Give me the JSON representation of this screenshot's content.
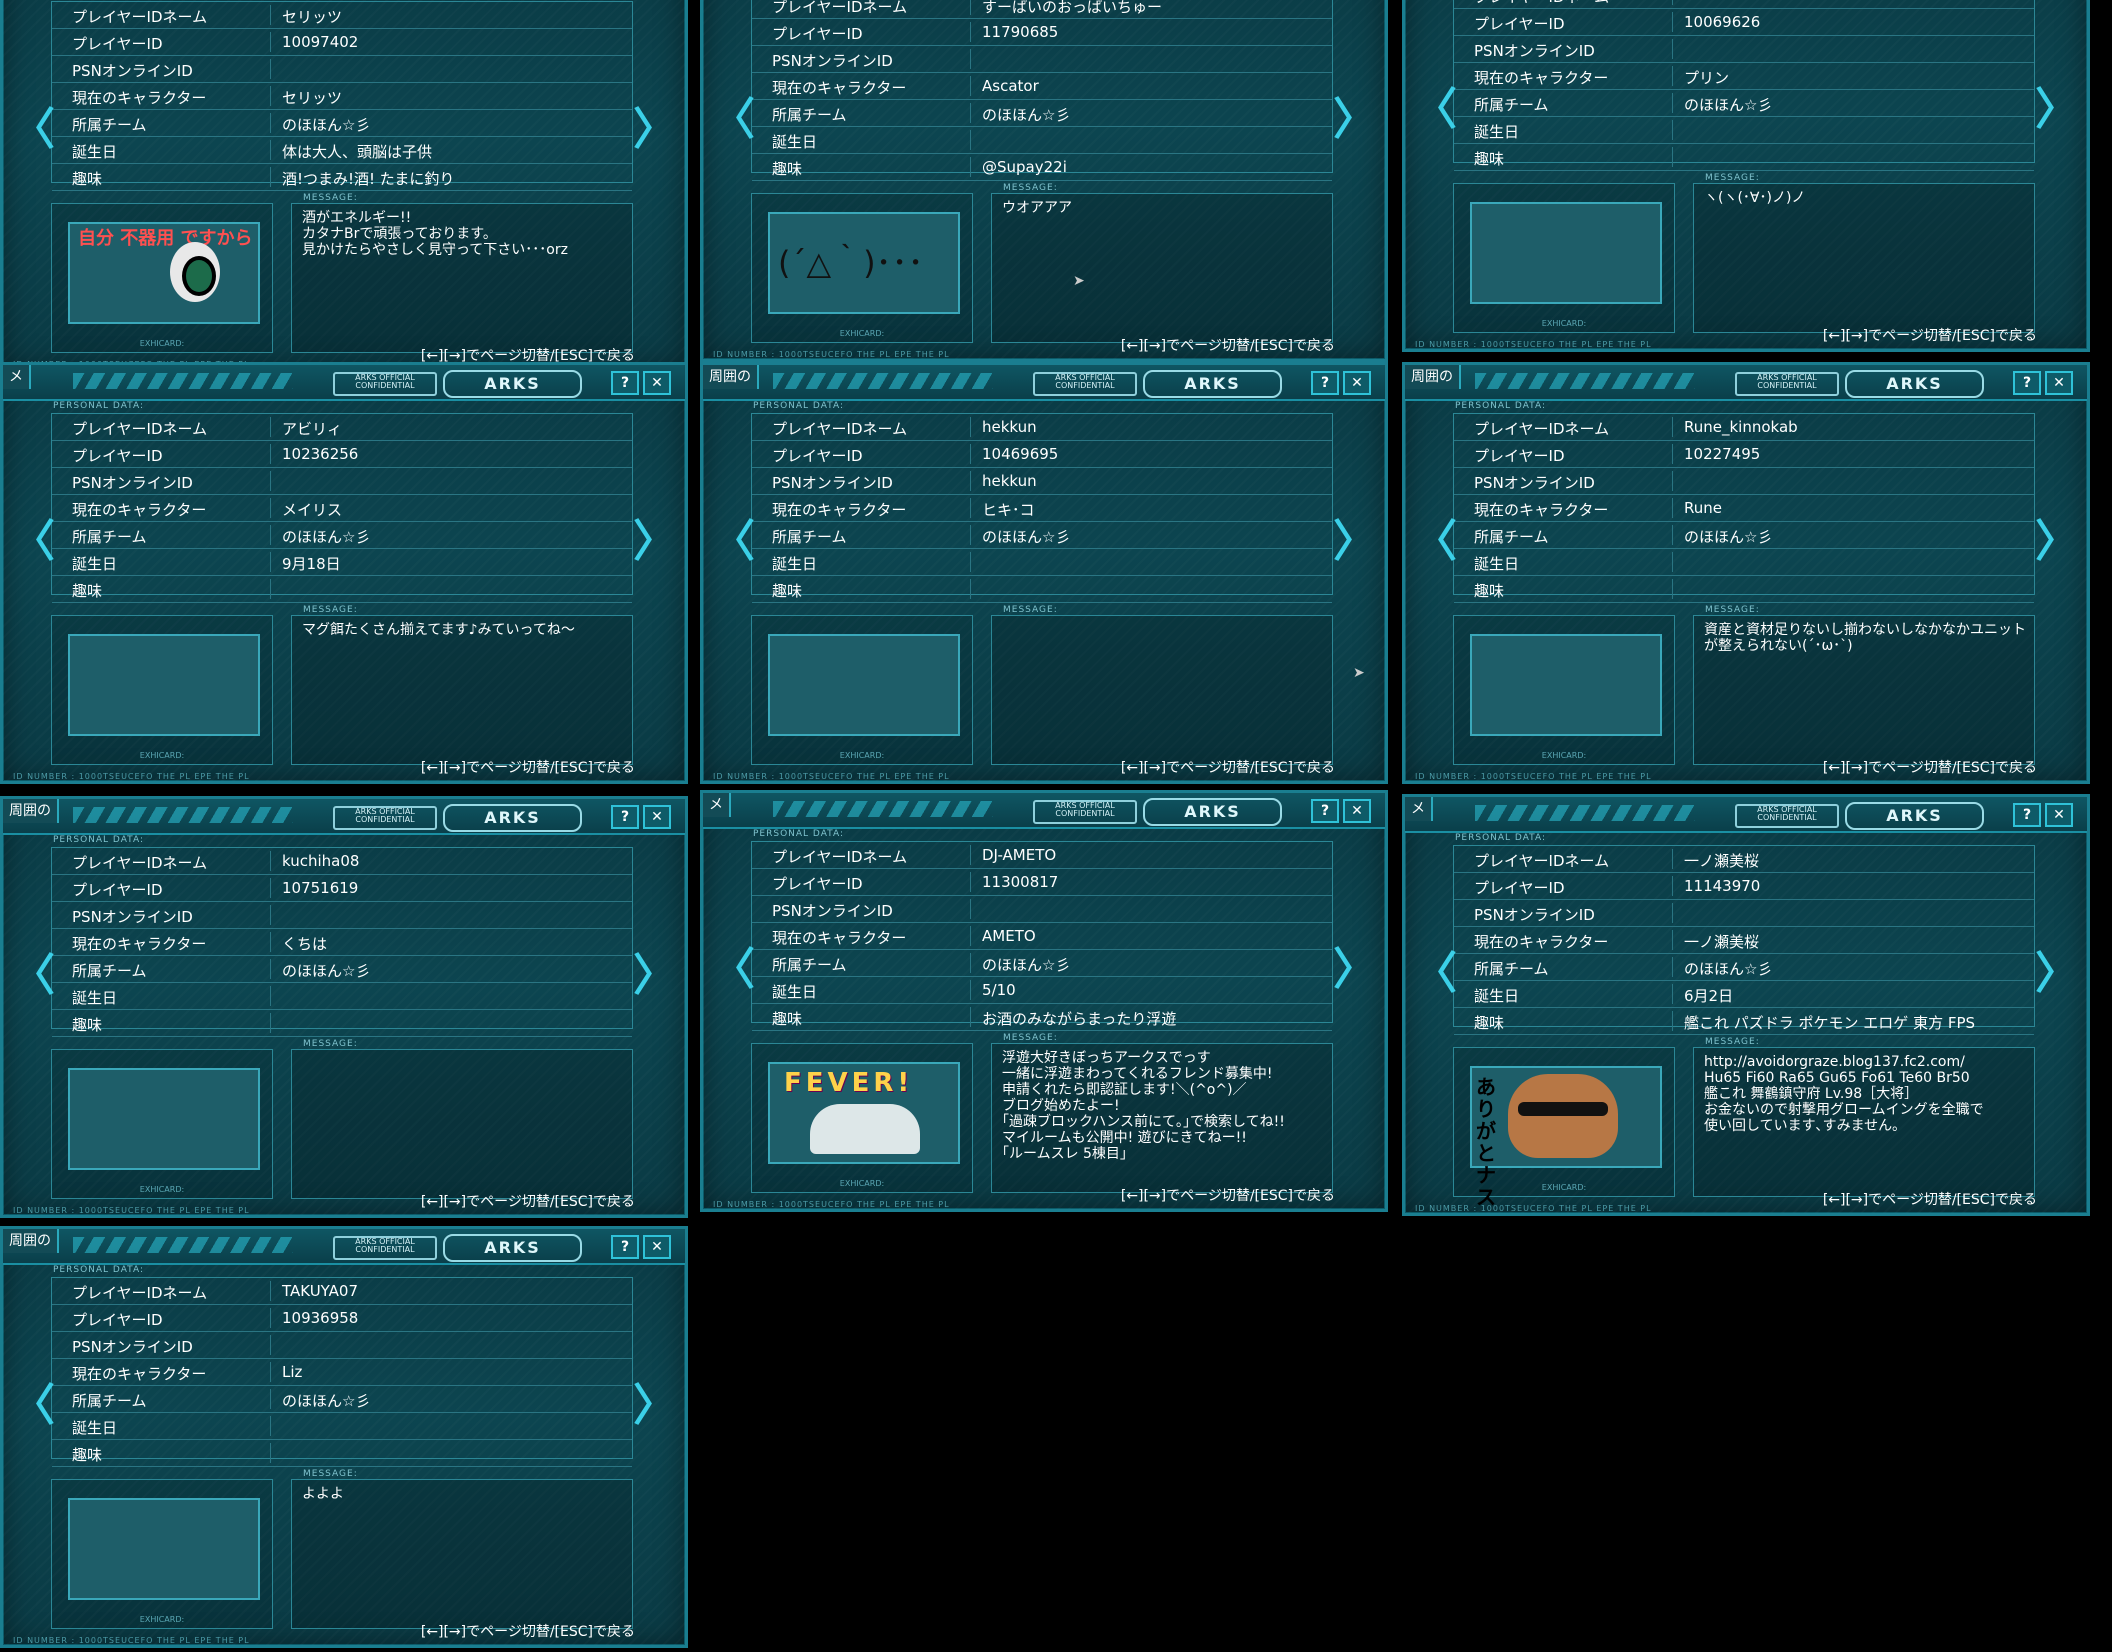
{
  "ui": {
    "personal_data_label": "PERSONAL DATA:",
    "message_label": "MESSAGE:",
    "card_label": "EXHICARD:",
    "help_button": "?",
    "close_button": "✕",
    "prev_arrow": "〈",
    "next_arrow": "〉",
    "hint": "[←][→]でページ切替/[ESC]で戻る",
    "ticker": "ID NUMBER : 1000TSEUCEFO THE PL EPE THE PL",
    "logo1": "ARKS OFFICIAL CONFIDENTIAL",
    "logo2": "ARKS",
    "field_labels": {
      "name": "プレイヤーIDネーム",
      "id": "プレイヤーID",
      "psn": "PSNオンラインID",
      "char": "現在のキャラクター",
      "team": "所属チーム",
      "birthday": "誕生日",
      "hobby": "趣味"
    }
  },
  "cards": [
    {
      "tab": "",
      "name": "セリッツ",
      "id": "10097402",
      "psn": "",
      "char": "セリッツ",
      "team": "のほほん☆彡",
      "birthday": "体は大人、頭脳は子供",
      "hobby": "酒!つまみ!酒! たまに釣り",
      "message": "酒がエネルギー!!\nカタナBrで頑張っております。\n見かけたらやさしく見守って下さい･･･orz",
      "art": "drunk",
      "art_text": "自分\n不器用\nですから"
    },
    {
      "tab": "",
      "name": "すーぱいのおっぱいちゅー",
      "id": "11790685",
      "psn": "",
      "char": "Ascator",
      "team": "のほほん☆彡",
      "birthday": "",
      "hobby": "@Supay22i",
      "message": "ウオアアア",
      "art": "face",
      "art_text": "(´△｀)･･･"
    },
    {
      "tab": "",
      "name": "",
      "id": "10069626",
      "psn": "",
      "char": "プリン",
      "team": "のほほん☆彡",
      "birthday": "",
      "hobby": "",
      "message": "ヽ(ヽ(･∀･)ノ)ノ",
      "art": "none",
      "art_text": ""
    },
    {
      "tab": "メ",
      "name": "アビリィ",
      "id": "10236256",
      "psn": "",
      "char": "メイリス",
      "team": "のほほん☆彡",
      "birthday": "9月18日",
      "hobby": "",
      "message": "マグ餌たくさん揃えてます♪みていってね～",
      "art": "none",
      "art_text": ""
    },
    {
      "tab": "周囲の",
      "name": "hekkun",
      "id": "10469695",
      "psn": "hekkun",
      "char": "ヒキ･コ",
      "team": "のほほん☆彡",
      "birthday": "",
      "hobby": "",
      "message": "",
      "art": "none",
      "art_text": ""
    },
    {
      "tab": "周囲の",
      "name": "Rune_kinnokab",
      "id": "10227495",
      "psn": "",
      "char": "Rune",
      "team": "のほほん☆彡",
      "birthday": "",
      "hobby": "",
      "message": "資産と資材足りないし揃わないしなかなかユニットが整えられない(´･ω･`)",
      "art": "none",
      "art_text": ""
    },
    {
      "tab": "周囲の",
      "name": "kuchiha08",
      "id": "10751619",
      "psn": "",
      "char": "くちは",
      "team": "のほほん☆彡",
      "birthday": "",
      "hobby": "",
      "message": "",
      "art": "none",
      "art_text": ""
    },
    {
      "tab": "メ",
      "name": "DJ-AMETO",
      "id": "11300817",
      "psn": "",
      "char": "AMETO",
      "team": "のほほん☆彡",
      "birthday": "5/10",
      "hobby": "お酒のみながらまったり浮遊",
      "message": "浮遊大好きぼっちアークスでっす\n一緒に浮遊まわってくれるフレンド募集中!\n申請くれたら即認証します!＼(^o^)／\nブログ始めたよー!\n｢過疎ブロックハンス前にて｡｣で検索してね!!\nマイルームも公開中! 遊びにきてねー!!\n｢ルームスレ 5棟目｣",
      "art": "fever",
      "art_text": "FEVER!"
    },
    {
      "tab": "メ",
      "name": "一ノ瀬美桜",
      "id": "11143970",
      "psn": "",
      "char": "一ノ瀬美桜",
      "team": "のほほん☆彡",
      "birthday": "6月2日",
      "hobby": "艦これ パズドラ ポケモン エロゲ 東方 FPS",
      "message": "http://avoidorgraze.blog137.fc2.com/\nHu65 Fi60 Ra65 Gu65 Fo61 Te60 Br50\n艦これ 舞鶴鎮守府 Lv.98［大将］\nお金ないので射撃用グロームイングを全職で\n使い回しています､すみません｡",
      "art": "nasu",
      "art_text": "ありがと ナス"
    },
    {
      "tab": "周囲の",
      "name": "TAKUYA07",
      "id": "10936958",
      "psn": "",
      "char": "Liz",
      "team": "のほほん☆彡",
      "birthday": "",
      "hobby": "",
      "message": "よよよ",
      "art": "none",
      "art_text": ""
    }
  ]
}
